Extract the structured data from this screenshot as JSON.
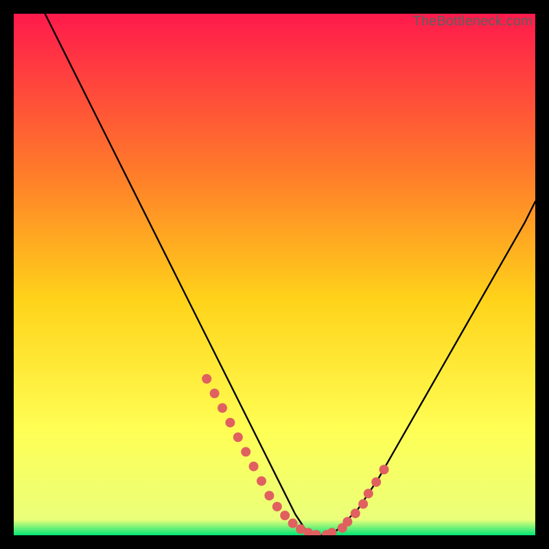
{
  "watermark": "TheBottleneck.com",
  "colors": {
    "frame_bg": "#000000",
    "gradient_top": "#ff1a4c",
    "gradient_mid1": "#ff7a2a",
    "gradient_mid2": "#ffd31a",
    "gradient_mid3": "#ffff55",
    "gradient_bottom": "#00e676",
    "curve": "#000000",
    "marker": "#e06060"
  },
  "chart_data": {
    "type": "line",
    "title": "",
    "xlabel": "",
    "ylabel": "",
    "xlim": [
      0,
      100
    ],
    "ylim": [
      0,
      100
    ],
    "grid": false,
    "series": [
      {
        "name": "bottleneck-curve",
        "x": [
          6,
          10,
          14,
          18,
          22,
          26,
          30,
          34,
          38,
          42,
          46,
          48,
          50,
          52,
          54,
          56,
          58,
          60,
          62,
          66,
          70,
          74,
          78,
          82,
          86,
          90,
          94,
          98,
          100
        ],
        "y": [
          100,
          92,
          84,
          76,
          68,
          60,
          52,
          44,
          36,
          28,
          20,
          16,
          12,
          8,
          4,
          1,
          0,
          0,
          1,
          5,
          11,
          18,
          25,
          32,
          39,
          46,
          53,
          60,
          64
        ]
      }
    ],
    "markers": {
      "name": "fit-markers",
      "x": [
        37,
        38.5,
        40,
        41.5,
        43,
        44.5,
        46,
        47.5,
        49,
        50.5,
        52,
        53.5,
        55,
        56.5,
        58,
        60,
        61,
        63,
        64,
        65.5,
        67,
        68,
        69.5,
        71
      ],
      "y": [
        30,
        27.2,
        24.4,
        21.6,
        18.8,
        16,
        13.2,
        10.4,
        7.6,
        5.5,
        3.8,
        2.3,
        1.2,
        0.5,
        0.1,
        0.1,
        0.5,
        1.4,
        2.6,
        4.2,
        6.0,
        8.0,
        10.2,
        12.6
      ]
    }
  }
}
